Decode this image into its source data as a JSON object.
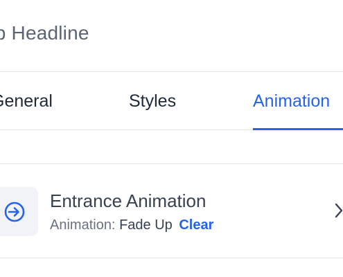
{
  "header": {
    "title": "ub Headline"
  },
  "tabs": [
    {
      "label": "General",
      "active": false
    },
    {
      "label": "Styles",
      "active": false
    },
    {
      "label": "Animation",
      "active": true
    }
  ],
  "animation_item": {
    "icon": "enter-arrow-circle-icon",
    "title": "Entrance Animation",
    "subtitle_label": "Animation:",
    "subtitle_value": "Fade Up",
    "clear_label": "Clear",
    "chevron_icon": "chevron-right-icon"
  },
  "colors": {
    "accent": "#2563eb",
    "text_primary": "#1f2937",
    "text_secondary": "#6b7280",
    "divider": "#e2e5ea",
    "icon_bg": "#f1f3f7"
  }
}
